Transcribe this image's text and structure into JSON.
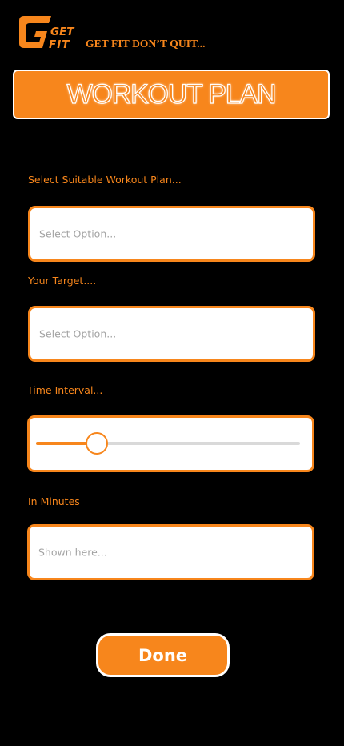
{
  "brand": {
    "logo_text_line1": "GET",
    "logo_text_line2": "FIT",
    "tagline": "GET FIT DON’T QUIT..."
  },
  "page_title": "WORKOUT PLAN",
  "form": {
    "workout_plan": {
      "label": "Select Suitable Workout Plan...",
      "placeholder": "Select Option..."
    },
    "target": {
      "label": "Your Target....",
      "placeholder": "Select Option..."
    },
    "time_interval": {
      "label": "Time Interval...",
      "slider_fraction": 0.2
    },
    "minutes": {
      "label": "In Minutes",
      "placeholder": "Shown here..."
    }
  },
  "done_label": "Done",
  "colors": {
    "accent": "#F7861C",
    "background": "#000000",
    "field_bg": "#FFFFFF",
    "placeholder": "#A3A3A3",
    "track": "#D9D9D9"
  },
  "icons": {
    "logo": "get-fit-logo-icon"
  }
}
